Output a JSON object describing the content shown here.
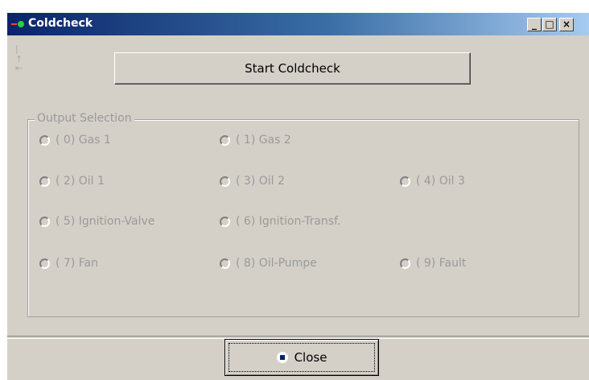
{
  "window": {
    "title": "Coldcheck",
    "controls": {
      "minimize": "_",
      "maximize": "□",
      "close": "×"
    }
  },
  "side_icons": {
    "top": "|↑",
    "bottom": "⇤"
  },
  "actions": {
    "start_label": "Start Coldcheck",
    "close_label": "Close"
  },
  "output_selection": {
    "legend": "Output Selection",
    "options": [
      {
        "label": "( 0) Gas 1",
        "selected": false,
        "enabled": false
      },
      {
        "label": "( 1) Gas 2",
        "selected": false,
        "enabled": false
      },
      {
        "label": "( 2) Oil 1",
        "selected": false,
        "enabled": false
      },
      {
        "label": "( 3) Oil 2",
        "selected": false,
        "enabled": false
      },
      {
        "label": "( 4) Oil 3",
        "selected": false,
        "enabled": false
      },
      {
        "label": "( 5) Ignition-Valve",
        "selected": false,
        "enabled": false
      },
      {
        "label": "( 6) Ignition-Transf.",
        "selected": false,
        "enabled": false
      },
      {
        "label": "( 7) Fan",
        "selected": false,
        "enabled": false
      },
      {
        "label": "( 8) Oil-Pumpe",
        "selected": false,
        "enabled": false
      },
      {
        "label": "( 9) Fault",
        "selected": false,
        "enabled": false
      }
    ]
  }
}
